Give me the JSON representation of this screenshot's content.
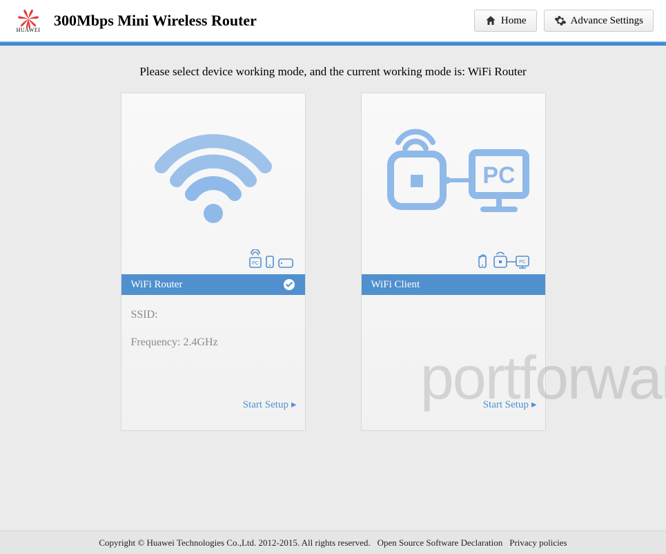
{
  "header": {
    "brand": "HUAWEI",
    "title": "300Mbps Mini Wireless Router",
    "home_label": "Home",
    "advance_label": "Advance Settings"
  },
  "prompt": "Please select device working mode, and the current working mode is: WiFi Router",
  "cards": {
    "router": {
      "band_label": "WiFi Router",
      "ssid_label": "SSID:",
      "ssid_value": "",
      "freq_label": "Frequency: 2.4GHz",
      "start_label": "Start Setup"
    },
    "client": {
      "band_label": "WiFi Client",
      "start_label": "Start Setup"
    }
  },
  "watermark": "portforwar",
  "footer": {
    "copyright": "Copyright © Huawei Technologies Co.,Ltd. 2012-2015. All rights reserved.",
    "oss": "Open Source Software Declaration",
    "privacy": "Privacy policies"
  }
}
